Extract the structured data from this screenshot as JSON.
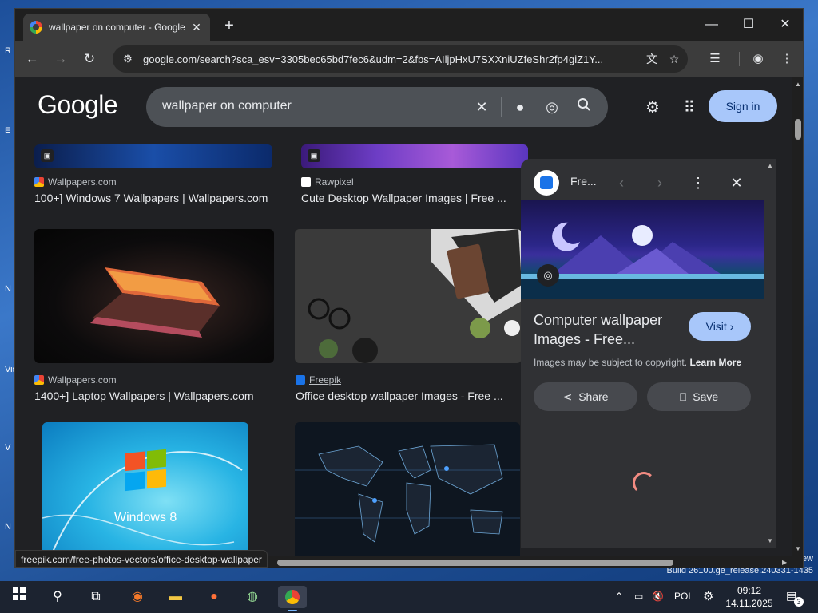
{
  "desktop": {
    "side_letters": [
      "R",
      "E",
      "N",
      "Vis",
      "V",
      "N"
    ],
    "right_edge_text": "ew",
    "build": "Build 26100.ge_release.240331-1435"
  },
  "browser": {
    "tab_title": "wallpaper on computer - Google",
    "tab_close": "✕",
    "new_tab": "+",
    "url": "google.com/search?sca_esv=3305bec65bd7fec6&udm=2&fbs=AIljpHxU7SXXniUZfeShr2fp4giZ1Y...",
    "status_url": "freepik.com/free-photos-vectors/office-desktop-wallpaper"
  },
  "google": {
    "logo": "Google",
    "query": "wallpaper on computer",
    "sign_in": "Sign in"
  },
  "results": [
    {
      "source": "Wallpapers.com",
      "title": "100+] Windows 7 Wallpapers | Wallpapers.com"
    },
    {
      "source": "Rawpixel",
      "title": "Cute Desktop Wallpaper Images | Free ..."
    },
    {
      "source": "Wallpapers.com",
      "title": "1400+] Laptop Wallpapers | Wallpapers.com"
    },
    {
      "source": "Freepik",
      "title": "Office desktop wallpaper Images - Free ..."
    }
  ],
  "thumbnail_text": {
    "windows8": "Windows 8"
  },
  "panel": {
    "site_name": "Fre...",
    "title": "Computer wallpaper Images - Free...",
    "visit": "Visit",
    "copyright": "Images may be subject to copyright.",
    "learn_more": "Learn More",
    "share": "Share",
    "save": "Save"
  },
  "taskbar": {
    "language": "POL",
    "time": "09:12",
    "date": "14.11.2025",
    "notification_count": "3"
  },
  "icons": {
    "back": "←",
    "forward": "→",
    "reload": "↻",
    "star": "☆",
    "menu": "⋮",
    "search": "⚲",
    "close": "✕",
    "mic": "🎤",
    "gear": "⚙",
    "apps": "⠿",
    "chev_left": "‹",
    "chev_right": "›",
    "chev_small": "›"
  },
  "colors": {
    "accent": "#a8c7fa",
    "page_bg": "#202124",
    "panel_bg": "#303134"
  }
}
